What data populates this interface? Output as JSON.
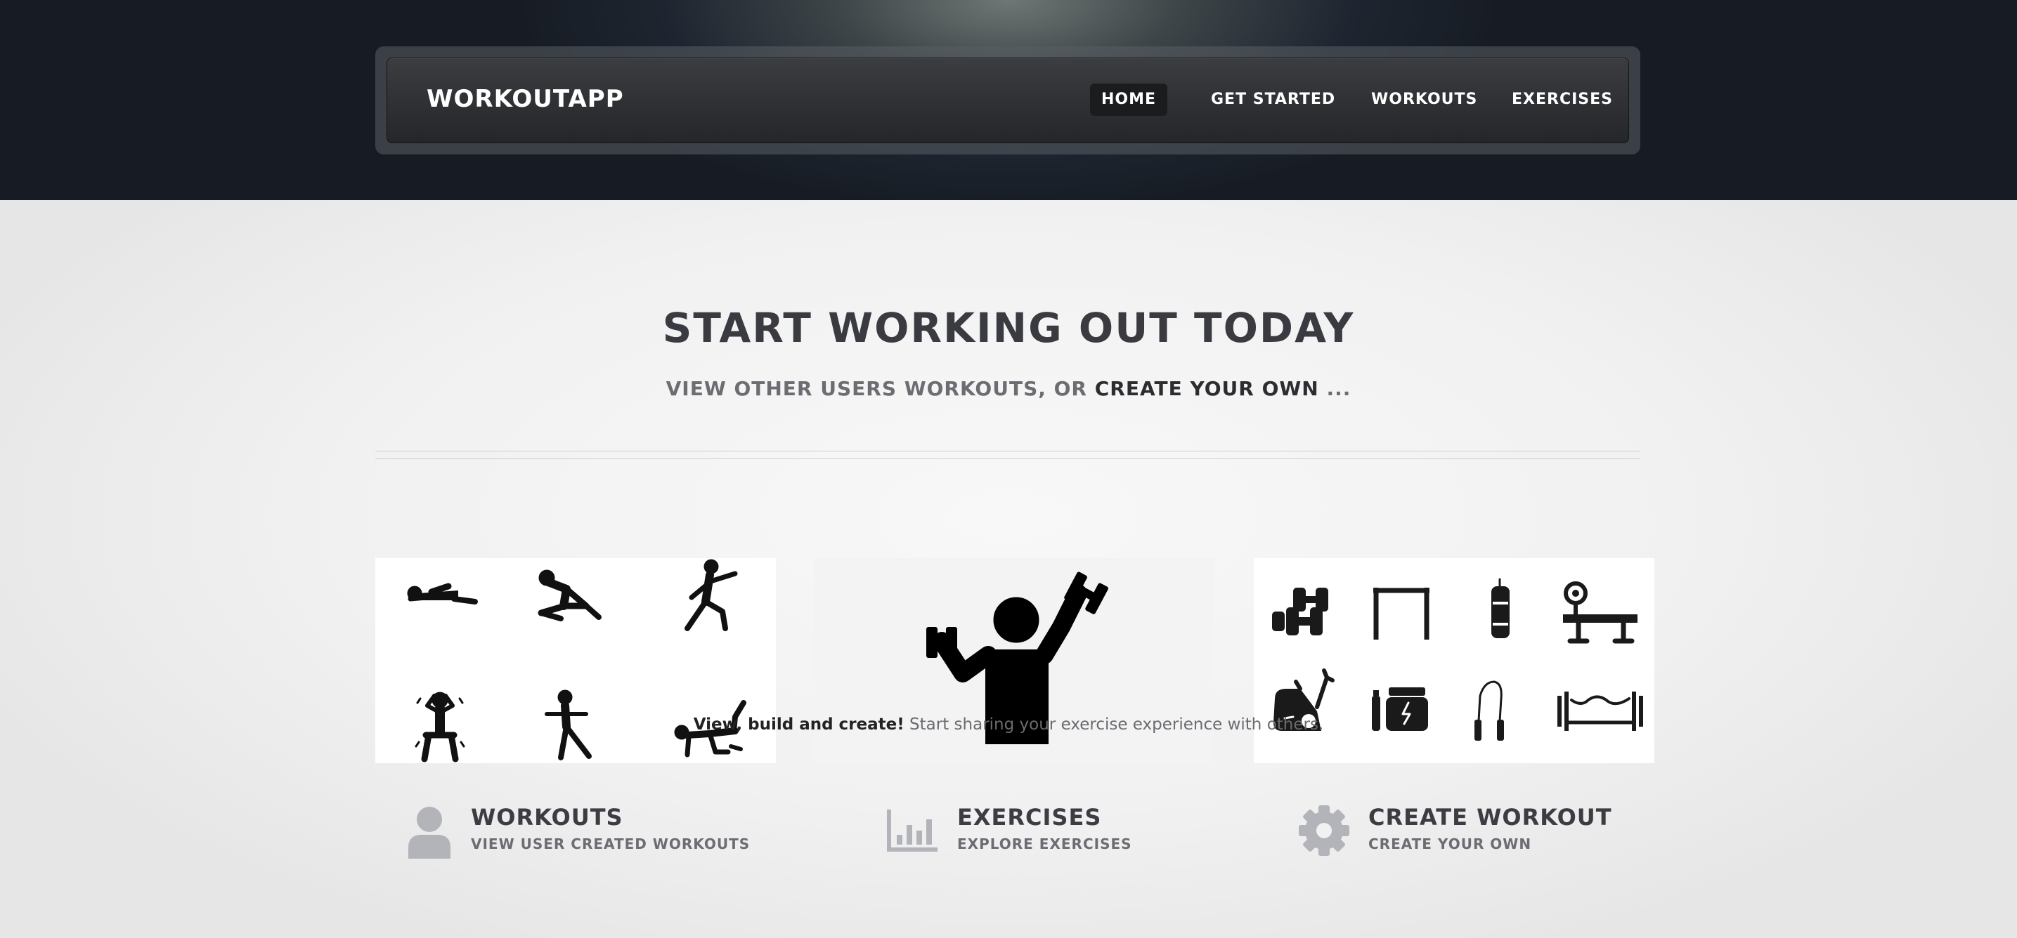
{
  "nav": {
    "brand": "WORKOUTAPP",
    "items": [
      {
        "label": "HOME",
        "active": true
      },
      {
        "label": "GET STARTED",
        "active": false
      },
      {
        "label": "WORKOUTS",
        "active": false
      },
      {
        "label": "EXERCISES",
        "active": false
      }
    ]
  },
  "hero": {
    "title": "START WORKING OUT TODAY",
    "subtitle_prefix": "VIEW OTHER USERS WORKOUTS, OR ",
    "subtitle_strong": "CREATE YOUR OWN",
    "subtitle_suffix": " ..."
  },
  "features": [
    {
      "icon": "user-icon",
      "title": "WORKOUTS",
      "subtitle": "VIEW USER CREATED WORKOUTS"
    },
    {
      "icon": "bar-chart-icon",
      "title": "EXERCISES",
      "subtitle": "EXPLORE EXERCISES"
    },
    {
      "icon": "gear-icon",
      "title": "CREATE WORKOUT",
      "subtitle": "CREATE YOUR OWN"
    }
  ],
  "footer": {
    "strong": "View, build and create!",
    "text": " Start sharing your exercise experience with others."
  },
  "colors": {
    "header_dark": "#1e2530",
    "nav_bar": "#2e3034",
    "heading": "#3a3b40",
    "icon_grey": "#b3b4ba"
  }
}
